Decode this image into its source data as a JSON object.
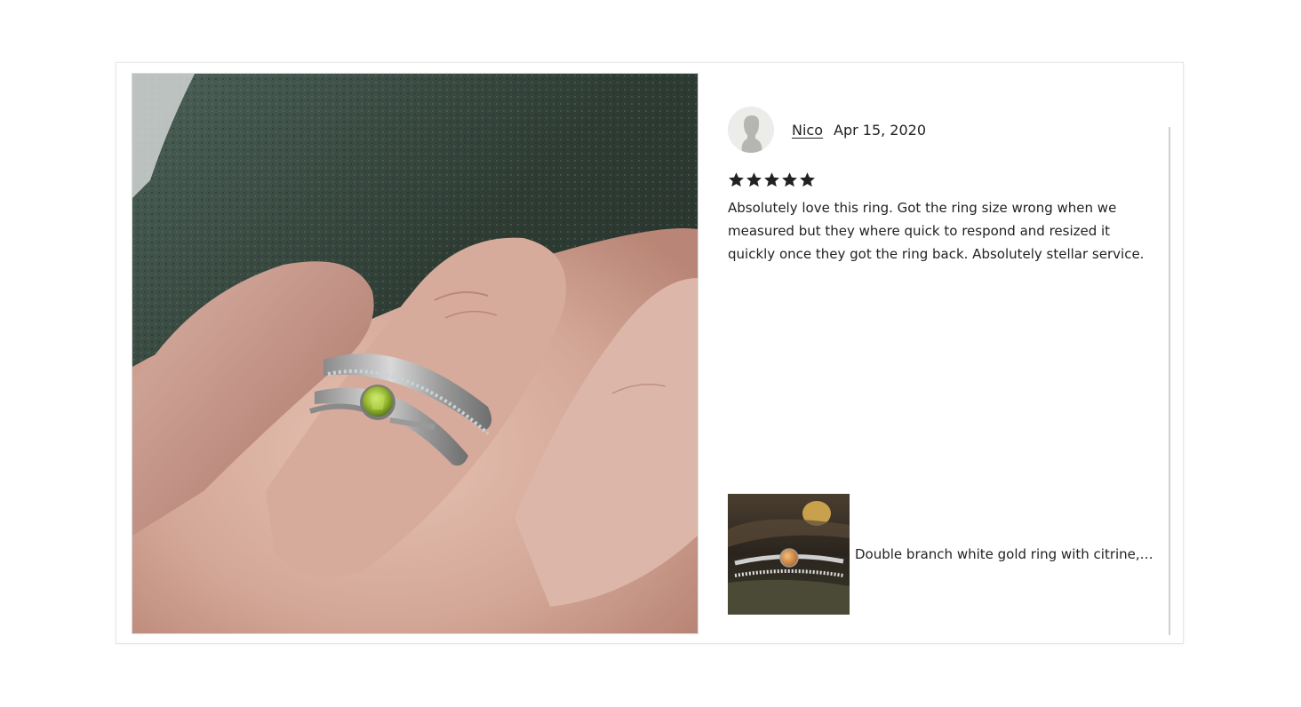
{
  "review": {
    "reviewer_name": "Nico",
    "date": "Apr 15, 2020",
    "rating": 5,
    "max_rating": 5,
    "text": "Absolutely love this ring. Got the ring size wrong when we measured but they where quick to respond and resized it quickly once they got the ring back. Absolutely stellar service.",
    "avatar_icon": "default-user-silhouette-icon",
    "star_icon": "star-icon",
    "photo_description_icon": "review-photo"
  },
  "product": {
    "title": "Double branch white gold ring with citrine, B..."
  },
  "colors": {
    "text": "#222222",
    "border": "#e6e6e6",
    "divider": "#cfcfcf",
    "star": "#222222"
  }
}
